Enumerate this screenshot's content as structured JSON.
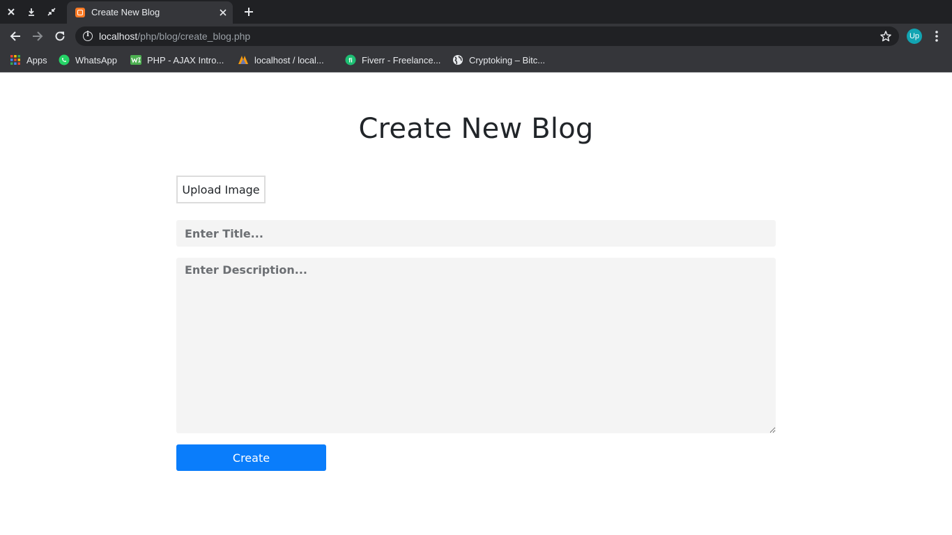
{
  "browser": {
    "tab": {
      "title": "Create New Blog"
    },
    "address_bar": {
      "host": "localhost",
      "path": "/php/blog/create_blog.php"
    },
    "profile": {
      "initials": "Up",
      "color": "#12a4b2"
    },
    "bookmarks": [
      {
        "label": "Apps",
        "icon": "apps-grid-icon"
      },
      {
        "label": "WhatsApp",
        "icon": "whatsapp-icon"
      },
      {
        "label": "PHP - AJAX Intro...",
        "icon": "w3schools-icon"
      },
      {
        "label": "localhost / local...",
        "icon": "phpmyadmin-icon"
      },
      {
        "label": "Fiverr - Freelance...",
        "icon": "fiverr-icon"
      },
      {
        "label": "Cryptoking – Bitc...",
        "icon": "globe-icon"
      }
    ]
  },
  "page": {
    "heading": "Create New Blog",
    "upload_button": "Upload Image",
    "title_placeholder": "Enter Title...",
    "description_placeholder": "Enter Description...",
    "create_button": "Create",
    "accent_color": "#0a7dfb"
  }
}
